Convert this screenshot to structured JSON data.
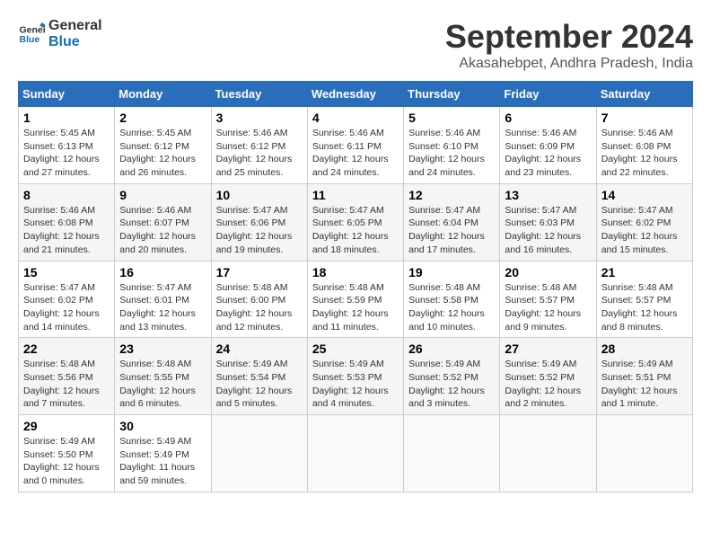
{
  "logo": {
    "line1": "General",
    "line2": "Blue"
  },
  "title": "September 2024",
  "subtitle": "Akasahebpet, Andhra Pradesh, India",
  "weekdays": [
    "Sunday",
    "Monday",
    "Tuesday",
    "Wednesday",
    "Thursday",
    "Friday",
    "Saturday"
  ],
  "weeks": [
    [
      {
        "day": "1",
        "info": "Sunrise: 5:45 AM\nSunset: 6:13 PM\nDaylight: 12 hours\nand 27 minutes."
      },
      {
        "day": "2",
        "info": "Sunrise: 5:45 AM\nSunset: 6:12 PM\nDaylight: 12 hours\nand 26 minutes."
      },
      {
        "day": "3",
        "info": "Sunrise: 5:46 AM\nSunset: 6:12 PM\nDaylight: 12 hours\nand 25 minutes."
      },
      {
        "day": "4",
        "info": "Sunrise: 5:46 AM\nSunset: 6:11 PM\nDaylight: 12 hours\nand 24 minutes."
      },
      {
        "day": "5",
        "info": "Sunrise: 5:46 AM\nSunset: 6:10 PM\nDaylight: 12 hours\nand 24 minutes."
      },
      {
        "day": "6",
        "info": "Sunrise: 5:46 AM\nSunset: 6:09 PM\nDaylight: 12 hours\nand 23 minutes."
      },
      {
        "day": "7",
        "info": "Sunrise: 5:46 AM\nSunset: 6:08 PM\nDaylight: 12 hours\nand 22 minutes."
      }
    ],
    [
      {
        "day": "8",
        "info": "Sunrise: 5:46 AM\nSunset: 6:08 PM\nDaylight: 12 hours\nand 21 minutes."
      },
      {
        "day": "9",
        "info": "Sunrise: 5:46 AM\nSunset: 6:07 PM\nDaylight: 12 hours\nand 20 minutes."
      },
      {
        "day": "10",
        "info": "Sunrise: 5:47 AM\nSunset: 6:06 PM\nDaylight: 12 hours\nand 19 minutes."
      },
      {
        "day": "11",
        "info": "Sunrise: 5:47 AM\nSunset: 6:05 PM\nDaylight: 12 hours\nand 18 minutes."
      },
      {
        "day": "12",
        "info": "Sunrise: 5:47 AM\nSunset: 6:04 PM\nDaylight: 12 hours\nand 17 minutes."
      },
      {
        "day": "13",
        "info": "Sunrise: 5:47 AM\nSunset: 6:03 PM\nDaylight: 12 hours\nand 16 minutes."
      },
      {
        "day": "14",
        "info": "Sunrise: 5:47 AM\nSunset: 6:02 PM\nDaylight: 12 hours\nand 15 minutes."
      }
    ],
    [
      {
        "day": "15",
        "info": "Sunrise: 5:47 AM\nSunset: 6:02 PM\nDaylight: 12 hours\nand 14 minutes."
      },
      {
        "day": "16",
        "info": "Sunrise: 5:47 AM\nSunset: 6:01 PM\nDaylight: 12 hours\nand 13 minutes."
      },
      {
        "day": "17",
        "info": "Sunrise: 5:48 AM\nSunset: 6:00 PM\nDaylight: 12 hours\nand 12 minutes."
      },
      {
        "day": "18",
        "info": "Sunrise: 5:48 AM\nSunset: 5:59 PM\nDaylight: 12 hours\nand 11 minutes."
      },
      {
        "day": "19",
        "info": "Sunrise: 5:48 AM\nSunset: 5:58 PM\nDaylight: 12 hours\nand 10 minutes."
      },
      {
        "day": "20",
        "info": "Sunrise: 5:48 AM\nSunset: 5:57 PM\nDaylight: 12 hours\nand 9 minutes."
      },
      {
        "day": "21",
        "info": "Sunrise: 5:48 AM\nSunset: 5:57 PM\nDaylight: 12 hours\nand 8 minutes."
      }
    ],
    [
      {
        "day": "22",
        "info": "Sunrise: 5:48 AM\nSunset: 5:56 PM\nDaylight: 12 hours\nand 7 minutes."
      },
      {
        "day": "23",
        "info": "Sunrise: 5:48 AM\nSunset: 5:55 PM\nDaylight: 12 hours\nand 6 minutes."
      },
      {
        "day": "24",
        "info": "Sunrise: 5:49 AM\nSunset: 5:54 PM\nDaylight: 12 hours\nand 5 minutes."
      },
      {
        "day": "25",
        "info": "Sunrise: 5:49 AM\nSunset: 5:53 PM\nDaylight: 12 hours\nand 4 minutes."
      },
      {
        "day": "26",
        "info": "Sunrise: 5:49 AM\nSunset: 5:52 PM\nDaylight: 12 hours\nand 3 minutes."
      },
      {
        "day": "27",
        "info": "Sunrise: 5:49 AM\nSunset: 5:52 PM\nDaylight: 12 hours\nand 2 minutes."
      },
      {
        "day": "28",
        "info": "Sunrise: 5:49 AM\nSunset: 5:51 PM\nDaylight: 12 hours\nand 1 minute."
      }
    ],
    [
      {
        "day": "29",
        "info": "Sunrise: 5:49 AM\nSunset: 5:50 PM\nDaylight: 12 hours\nand 0 minutes."
      },
      {
        "day": "30",
        "info": "Sunrise: 5:49 AM\nSunset: 5:49 PM\nDaylight: 11 hours\nand 59 minutes."
      },
      {
        "day": "",
        "info": ""
      },
      {
        "day": "",
        "info": ""
      },
      {
        "day": "",
        "info": ""
      },
      {
        "day": "",
        "info": ""
      },
      {
        "day": "",
        "info": ""
      }
    ]
  ]
}
